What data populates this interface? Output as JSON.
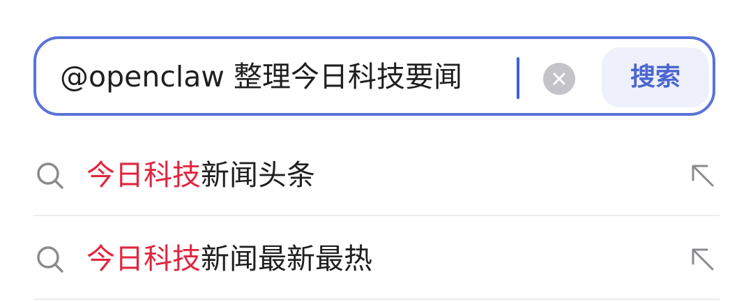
{
  "search": {
    "query": "@openclaw 整理今日科技要闻",
    "button_label": "搜索",
    "clear_icon": "clear-icon"
  },
  "suggestions": [
    {
      "highlight": "今日科技",
      "rest": "新闻头条",
      "icon": "search-icon",
      "action_icon": "arrow-up-left-icon"
    },
    {
      "highlight": "今日科技",
      "rest": "新闻最新最热",
      "icon": "search-icon",
      "action_icon": "arrow-up-left-icon"
    }
  ],
  "colors": {
    "accent": "#5a73d9",
    "highlight": "#e0263f",
    "button_text": "#4a66cf",
    "button_bg": "#eef1fb"
  }
}
